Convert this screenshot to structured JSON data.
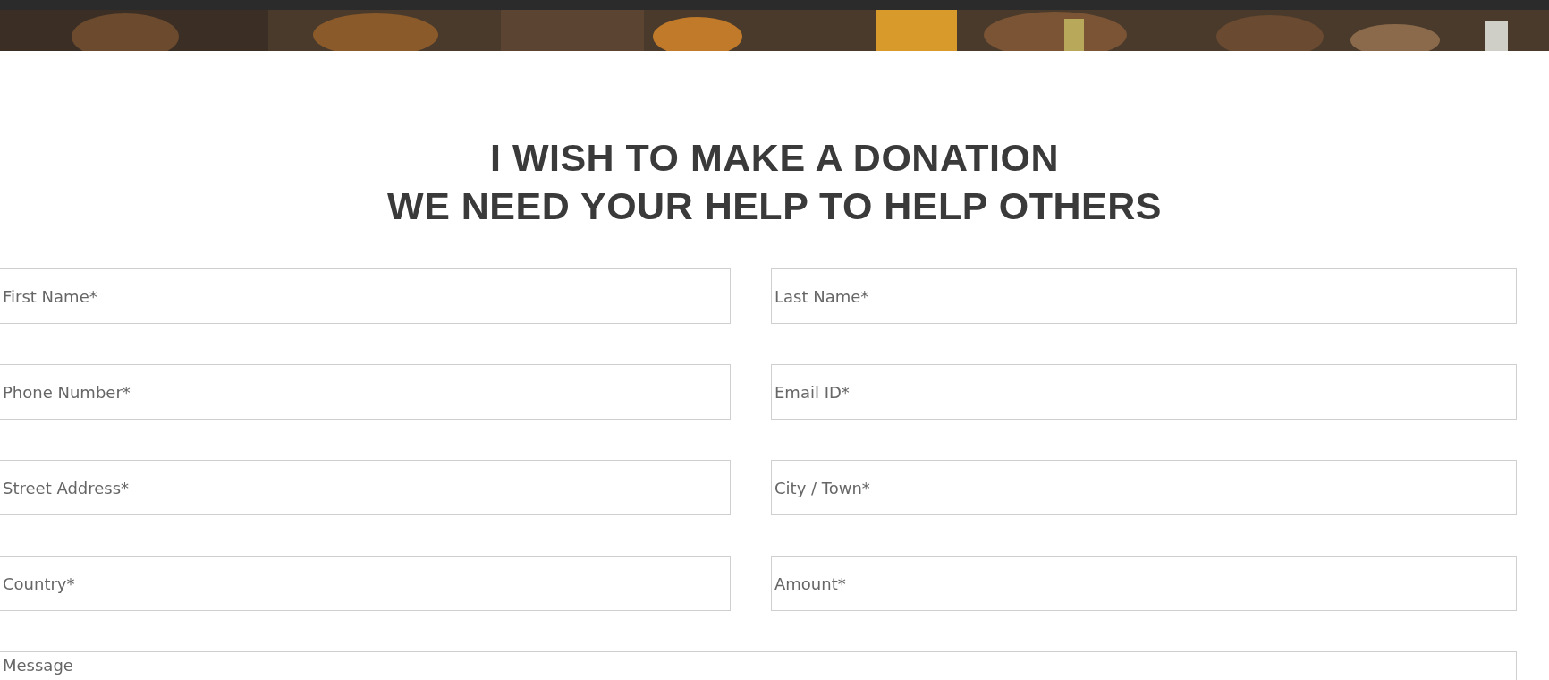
{
  "heading": {
    "lines": [
      "I WISH TO MAKE A DONATION",
      "WE NEED YOUR HELP TO HELP OTHERS"
    ]
  },
  "form": {
    "fields": [
      {
        "placeholder": "First Name*"
      },
      {
        "placeholder": "Last Name*"
      },
      {
        "placeholder": "Phone Number*"
      },
      {
        "placeholder": "Email ID*"
      },
      {
        "placeholder": "Street Address*"
      },
      {
        "placeholder": "City / Town*"
      },
      {
        "placeholder": "Country*"
      },
      {
        "placeholder": "Amount*"
      }
    ],
    "message": {
      "placeholder": "Message"
    }
  }
}
